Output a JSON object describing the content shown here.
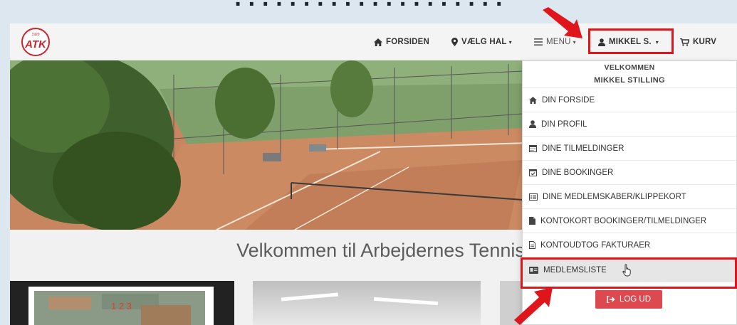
{
  "navbar": {
    "logo_text": "ATK",
    "logo_year": "1929",
    "items": [
      {
        "label": "FORSIDEN",
        "icon": "home-icon"
      },
      {
        "label": "VÆLG HAL",
        "icon": "map-marker-icon"
      },
      {
        "label": "MENU",
        "icon": "hamburger-icon"
      },
      {
        "label": "MIKKEL S.",
        "icon": "user-icon"
      },
      {
        "label": "KURV",
        "icon": "cart-icon"
      }
    ],
    "caret": "▾"
  },
  "dropdown": {
    "greeting": "VELKOMMEN",
    "user_name": "MIKKEL STILLING",
    "items": [
      {
        "label": "DIN FORSIDE",
        "icon": "home-icon"
      },
      {
        "label": "DIN PROFIL",
        "icon": "user-icon"
      },
      {
        "label": "DINE TILMELDINGER",
        "icon": "calendar-icon"
      },
      {
        "label": "DINE BOOKINGER",
        "icon": "calendar-check-icon"
      },
      {
        "label": "DINE MEDLEMSKABER/KLIPPEKORT",
        "icon": "card-list-icon"
      },
      {
        "label": "KONTOKORT BOOKINGER/TILMELDINGER",
        "icon": "file-icon"
      },
      {
        "label": "KONTOUDTOG FAKTURAER",
        "icon": "file-outline-icon"
      },
      {
        "label": "MEDLEMSLISTE",
        "icon": "id-card-icon"
      }
    ],
    "logout_label": "LOG UD"
  },
  "main": {
    "welcome_heading": "Velkommen til Arbejdernes Tennis"
  },
  "colors": {
    "highlight": "#e0141b",
    "logout": "#dc4a4f",
    "logo": "#c8262b"
  }
}
